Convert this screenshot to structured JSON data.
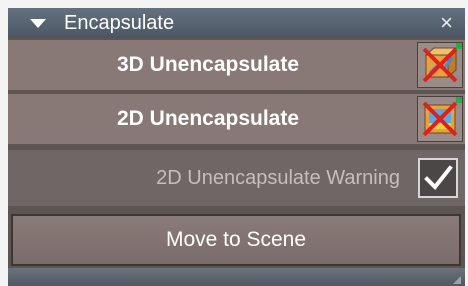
{
  "panel": {
    "title": "Encapsulate",
    "close_glyph": "×"
  },
  "actions": [
    {
      "label": "3D Unencapsulate",
      "icon": "unencapsulate-3d-icon"
    },
    {
      "label": "2D Unencapsulate",
      "icon": "unencapsulate-2d-icon"
    }
  ],
  "warning": {
    "label": "2D Unencapsulate Warning",
    "checked": true
  },
  "move_button": {
    "label": "Move to Scene"
  },
  "colors": {
    "titlebar": "#5a6572",
    "row": "#887876",
    "body": "#5d5552",
    "icon_cross": "#e0201a",
    "icon_blue": "#3a8fd8",
    "icon_orange": "#e89a30"
  }
}
